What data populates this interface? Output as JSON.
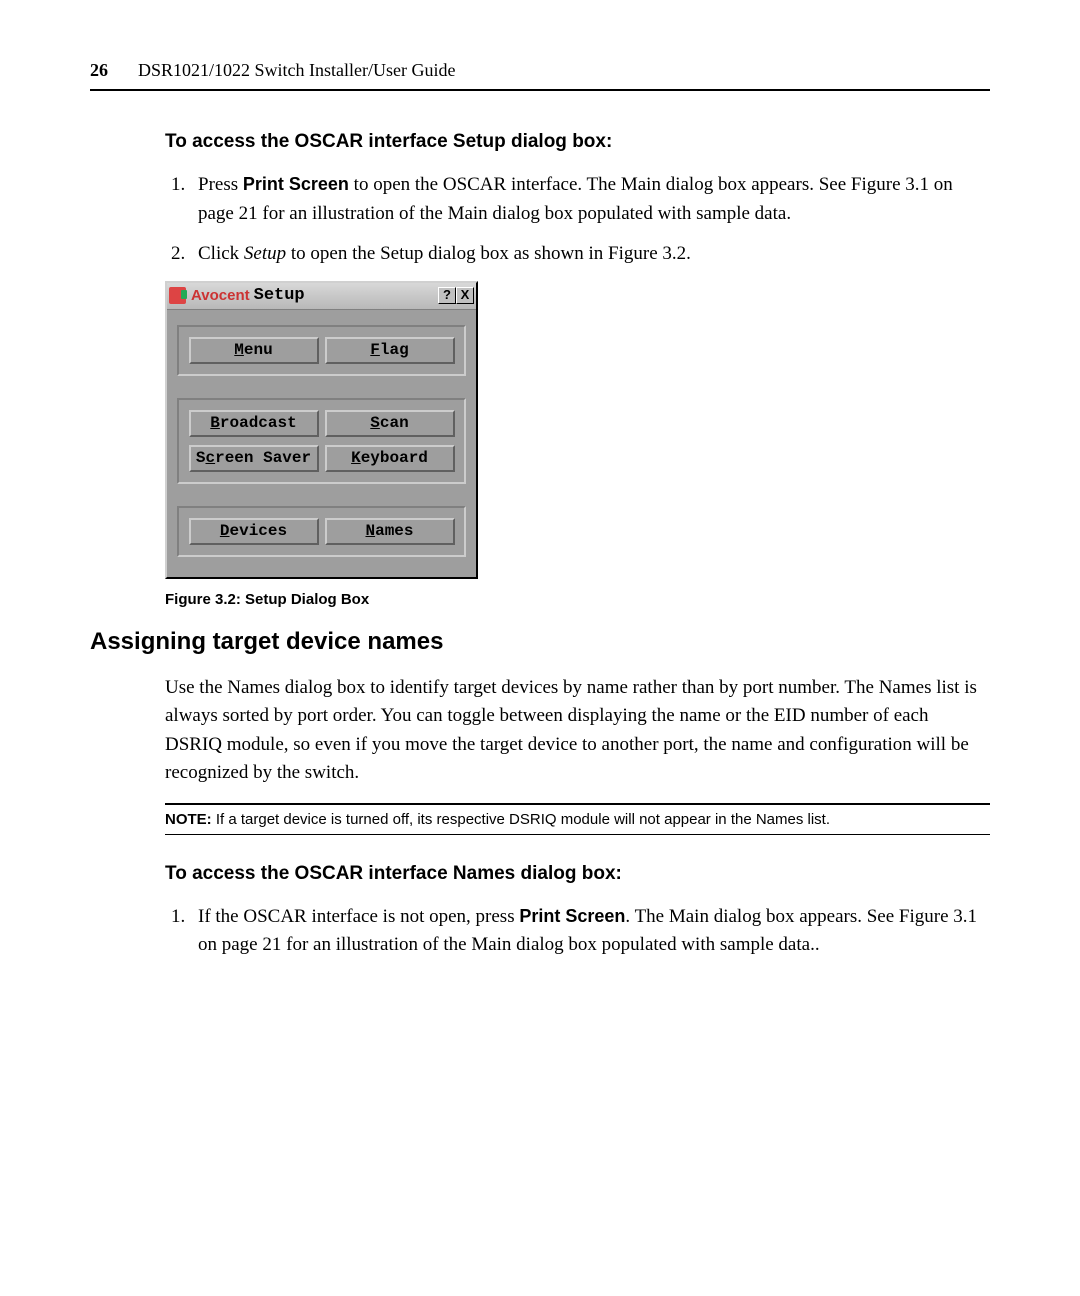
{
  "header": {
    "page_number": "26",
    "guide_title": "DSR1021/1022 Switch Installer/User Guide"
  },
  "section1": {
    "heading": "To access the OSCAR interface Setup dialog box:",
    "step1_pre": "Press ",
    "step1_bold": "Print Screen",
    "step1_post": " to open the OSCAR interface. The Main dialog box appears. See Figure 3.1 on page 21 for an illustration of the Main dialog box populated with sample data.",
    "step2_pre": "Click ",
    "step2_italic": "Setup",
    "step2_post": " to open the Setup dialog box as shown in Figure 3.2."
  },
  "dialog": {
    "brand": "Avocent",
    "title": "Setup",
    "help_btn": "?",
    "close_btn": "X",
    "buttons": {
      "menu": "enu",
      "flag": "lag",
      "broadcast": "roadcast",
      "scan": "can",
      "screen_saver_pre": "S",
      "screen_saver_mid": "c",
      "screen_saver_post": "reen Saver",
      "keyboard": "eyboard",
      "devices": "evices",
      "names": "ames"
    }
  },
  "figure_caption": "Figure 3.2: Setup Dialog Box",
  "main_heading": "Assigning target device names",
  "paragraph": "Use the Names dialog box to identify target devices by name rather than by port number. The Names list is always sorted by port order. You can toggle between displaying the name or the EID number of each DSRIQ module, so even if you move the target device to another port, the name and configuration will be recognized by the switch.",
  "note": {
    "label": "NOTE:",
    "text": "  If a target device is turned off, its respective DSRIQ module will not appear in the Names list."
  },
  "section2": {
    "heading": "To access the OSCAR interface Names dialog box:",
    "step1_pre": "If the OSCAR interface is not open, press ",
    "step1_bold": "Print Screen",
    "step1_post": ". The Main dialog box appears. See Figure 3.1 on page 21 for an illustration of the Main dialog box populated with sample data.."
  }
}
